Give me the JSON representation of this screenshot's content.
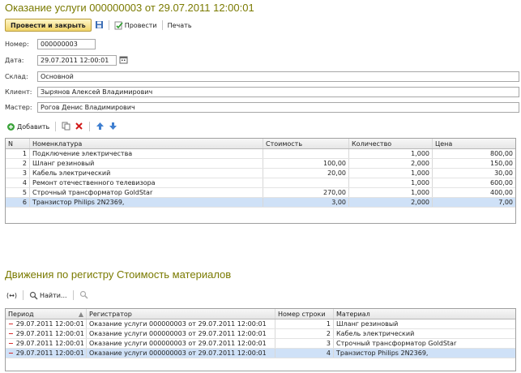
{
  "doc": {
    "title": "Оказание услуги 000000003 от 29.07.2011 12:00:01",
    "toolbar": {
      "post_close": "Провести и закрыть",
      "post": "Провести",
      "print": "Печать"
    },
    "fields": {
      "number_label": "Номер:",
      "number_value": "000000003",
      "date_label": "Дата:",
      "date_value": "29.07.2011 12:00:01",
      "warehouse_label": "Склад:",
      "warehouse_value": "Основной",
      "client_label": "Клиент:",
      "client_value": "Зырянов Алексей Владимирович",
      "master_label": "Мастер:",
      "master_value": "Рогов Денис Владимирович"
    },
    "grid_toolbar": {
      "add": "Добавить"
    },
    "table": {
      "headers": {
        "n": "N",
        "nomen": "Номенклатура",
        "cost": "Стоимость",
        "qty": "Количество",
        "price": "Цена"
      },
      "rows": [
        {
          "n": "1",
          "nomen": "Подключение электричества",
          "cost": "",
          "qty": "1,000",
          "price": "800,00"
        },
        {
          "n": "2",
          "nomen": "Шланг резиновый",
          "cost": "100,00",
          "qty": "2,000",
          "price": "150,00"
        },
        {
          "n": "3",
          "nomen": "Кабель электрический",
          "cost": "20,00",
          "qty": "1,000",
          "price": "30,00"
        },
        {
          "n": "4",
          "nomen": "Ремонт отечественного телевизора",
          "cost": "",
          "qty": "1,000",
          "price": "600,00"
        },
        {
          "n": "5",
          "nomen": "Строчный трансформатор GoldStar",
          "cost": "270,00",
          "qty": "1,000",
          "price": "400,00"
        },
        {
          "n": "6",
          "nomen": "Транзистор Philips 2N2369,",
          "cost": "3,00",
          "qty": "2,000",
          "price": "7,00"
        }
      ]
    }
  },
  "register": {
    "title": "Движения  по регистру Стоимость материалов",
    "toolbar": {
      "find": "Найти..."
    },
    "table": {
      "headers": {
        "period": "Период",
        "registrar": "Регистратор",
        "line": "Номер строки",
        "material": "Материал"
      },
      "rows": [
        {
          "period": "29.07.2011 12:00:01",
          "registrar": "Оказание услуги 000000003 от 29.07.2011 12:00:01",
          "line": "1",
          "material": "Шланг резиновый"
        },
        {
          "period": "29.07.2011 12:00:01",
          "registrar": "Оказание услуги 000000003 от 29.07.2011 12:00:01",
          "line": "2",
          "material": "Кабель электрический"
        },
        {
          "period": "29.07.2011 12:00:01",
          "registrar": "Оказание услуги 000000003 от 29.07.2011 12:00:01",
          "line": "3",
          "material": "Строчный трансформатор GoldStar"
        },
        {
          "period": "29.07.2011 12:00:01",
          "registrar": "Оказание услуги 000000003 от 29.07.2011 12:00:01",
          "line": "4",
          "material": "Транзистор Philips 2N2369,"
        }
      ]
    }
  }
}
